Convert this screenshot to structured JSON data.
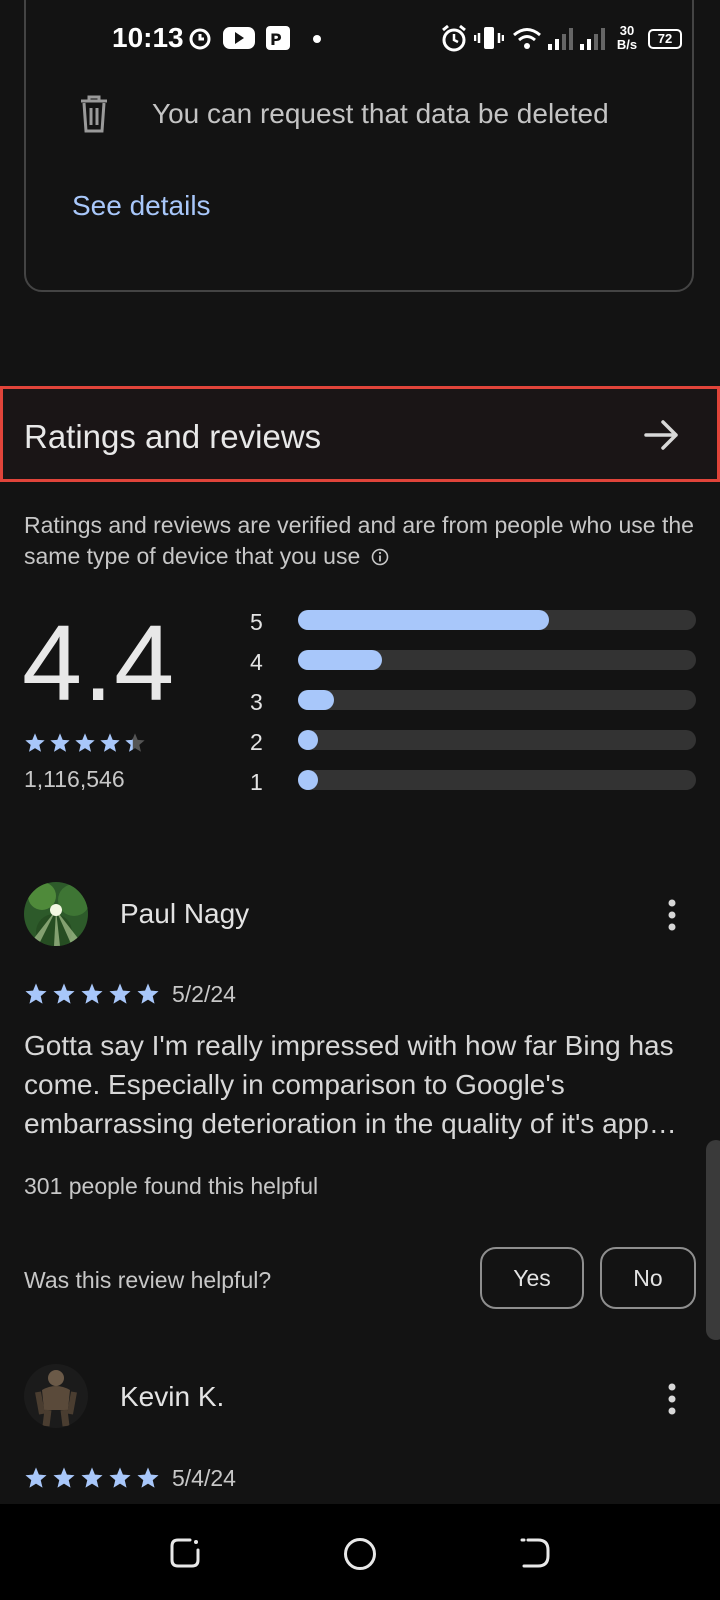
{
  "status_bar": {
    "time": "10:13",
    "net_speed_top": "30",
    "net_speed_bottom": "B/s",
    "battery": "72"
  },
  "data_safety": {
    "delete_text": "You can request that data be deleted",
    "see_details": "See details"
  },
  "ratings": {
    "title": "Ratings and reviews",
    "note": "Ratings and reviews are verified and are from people who use the same type of device that you use",
    "average": "4.4",
    "count": "1,116,546",
    "star_value": 4.4,
    "distribution": [
      {
        "label": "5",
        "fraction": 0.63
      },
      {
        "label": "4",
        "fraction": 0.21
      },
      {
        "label": "3",
        "fraction": 0.09
      },
      {
        "label": "2",
        "fraction": 0.05
      },
      {
        "label": "1",
        "fraction": 0.05
      }
    ]
  },
  "reviews": [
    {
      "name": "Paul Nagy",
      "stars": 5,
      "date": "5/2/24",
      "text": "Gotta say I'm really impressed with how far Bing has come. Especially in comparison to Google's embarrassing deterioration in the quality of it's app…",
      "helpful_count": "301 people found this helpful",
      "helpful_question": "Was this review helpful?",
      "yes": "Yes",
      "no": "No"
    },
    {
      "name": "Kevin K.",
      "stars": 5,
      "date": "5/4/24"
    }
  ],
  "colors": {
    "accent": "#a8c7fa",
    "highlight_border": "#e0443a",
    "background": "#131313"
  },
  "icons": [
    "trash-icon",
    "arrow-right-icon",
    "info-icon",
    "star-icon",
    "more-vert-icon",
    "recents-icon",
    "home-icon",
    "back-icon"
  ]
}
